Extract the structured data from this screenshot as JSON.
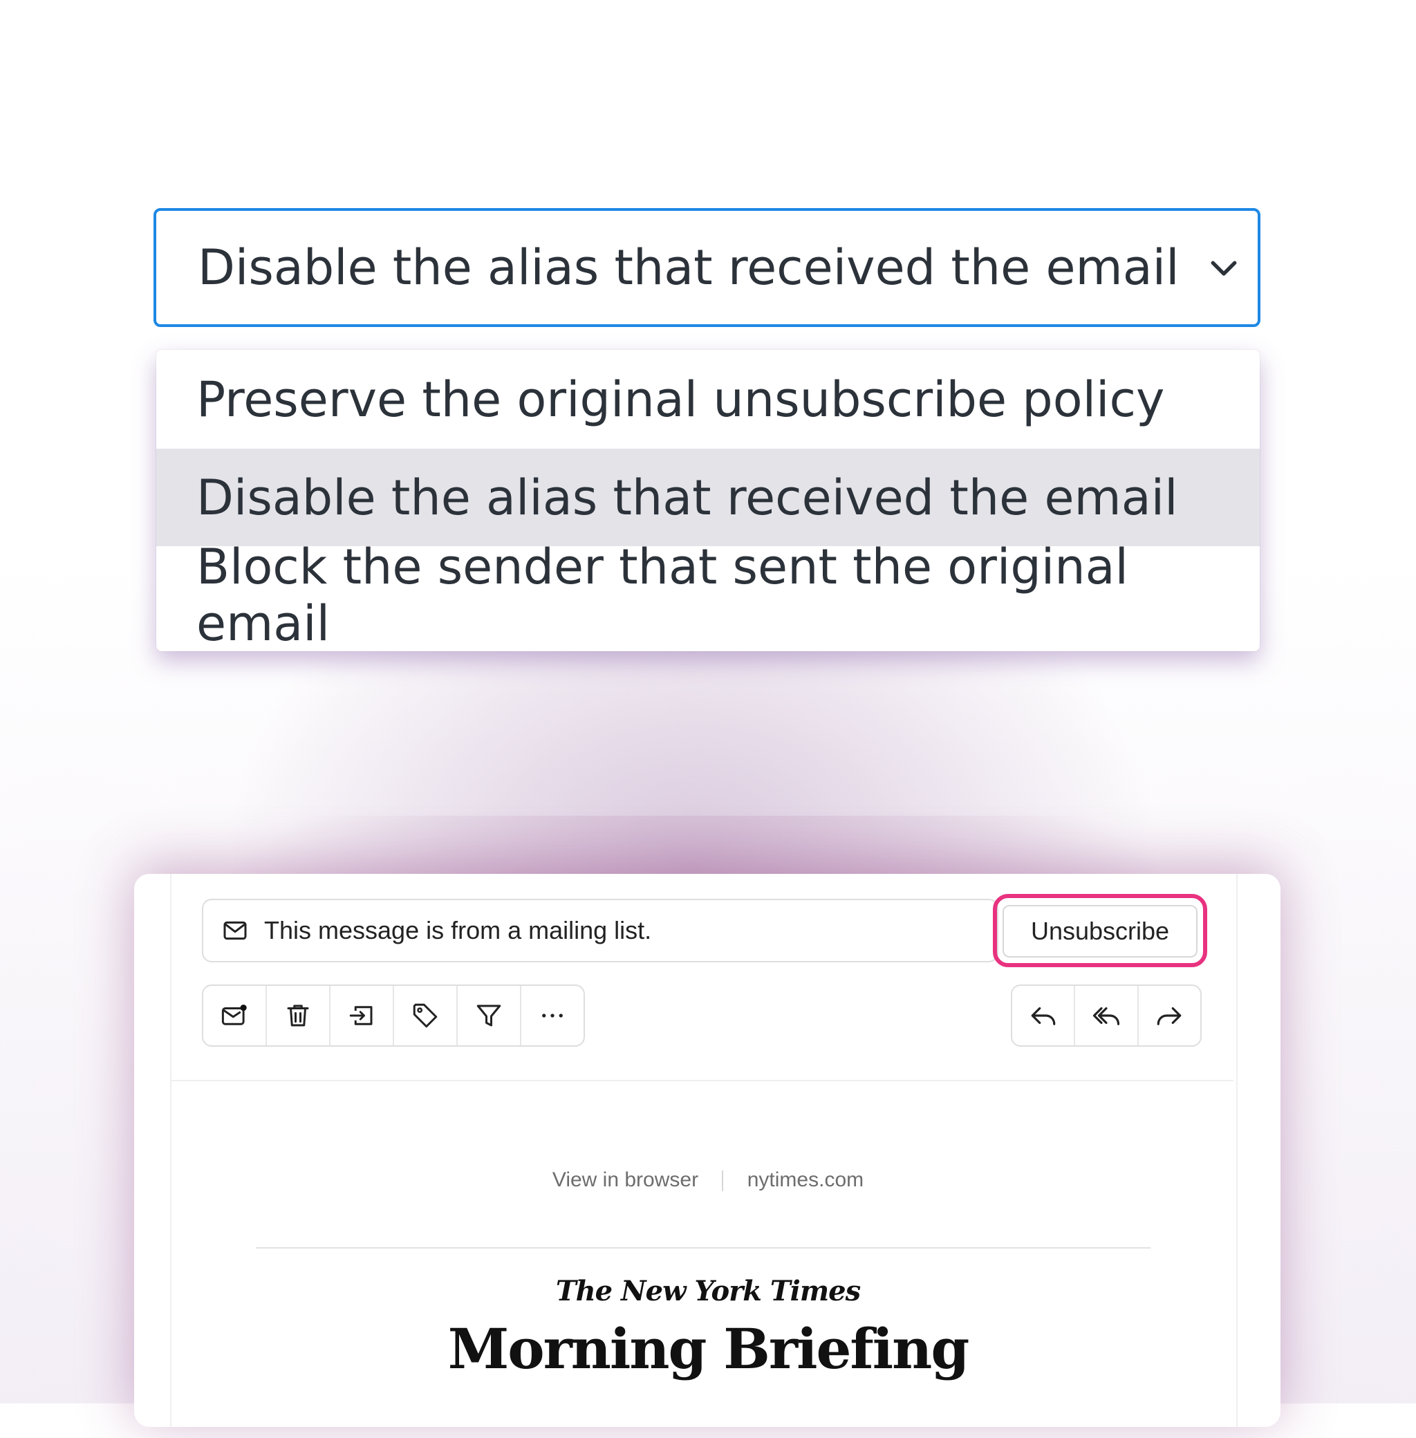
{
  "select": {
    "current_value": "Disable the alias that received the email",
    "options": [
      {
        "label": "Preserve the original unsubscribe policy"
      },
      {
        "label": "Disable the alias that received the email",
        "selected": true
      },
      {
        "label": "Block the sender that sent the original email"
      }
    ]
  },
  "mail": {
    "banner_text": "This message is from a mailing list.",
    "unsubscribe_label": "Unsubscribe",
    "toolbar_left": [
      "mark-unread-icon",
      "trash-icon",
      "move-icon",
      "tag-icon",
      "filter-icon",
      "more-icon"
    ],
    "toolbar_right": [
      "reply-icon",
      "reply-all-icon",
      "forward-icon"
    ],
    "view_in_browser": "View in browser",
    "site_link": "nytimes.com",
    "publication": "The New York Times",
    "newsletter_title": "Morning Briefing"
  },
  "colors": {
    "focus_border": "#1e88e5",
    "highlight": "#e8327f",
    "selected_option_bg": "#e3e3e8"
  }
}
